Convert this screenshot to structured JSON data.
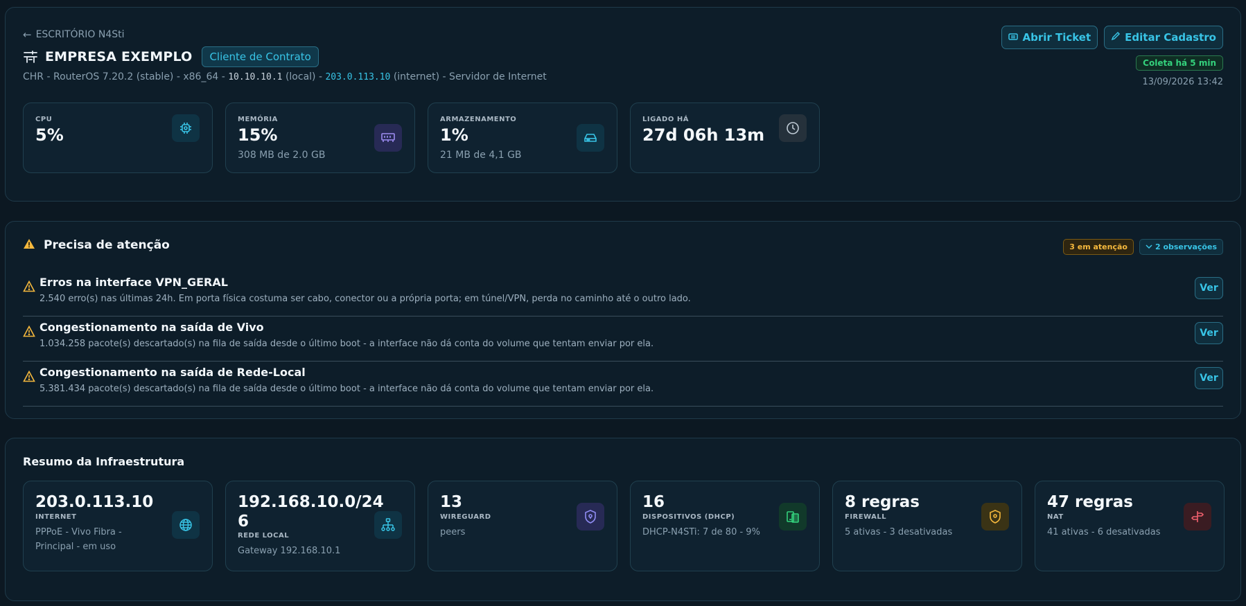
{
  "header": {
    "back_label": "ESCRITÓRIO N4Sti",
    "company": "EMPRESA EXEMPLO",
    "contract_badge": "Cliente de Contrato",
    "sub": {
      "model": "CHR - RouterOS 7.20.2 (stable) - x86_64 - ",
      "local_ip": "10.10.10.1",
      "local_label": " (local) - ",
      "public_ip": "203.0.113.10",
      "public_label": " (internet) - Servidor de Internet"
    },
    "actions": {
      "open_ticket": "Abrir Ticket",
      "edit": "Editar Cadastro"
    },
    "collect_status": "Coleta há 5 min",
    "timestamp": "13/09/2026 13:42"
  },
  "stats": [
    {
      "label": "CPU",
      "value": "5%",
      "sub": "",
      "icon": "cpu-icon"
    },
    {
      "label": "MEMÓRIA",
      "value": "15%",
      "sub": "308 MB de 2.0 GB",
      "icon": "memory-icon"
    },
    {
      "label": "ARMAZENAMENTO",
      "value": "1%",
      "sub": "21 MB de 4,1 GB",
      "icon": "storage-icon"
    },
    {
      "label": "LIGADO HÁ",
      "value": "27d 06h 13m",
      "sub": "",
      "icon": "clock-icon"
    }
  ],
  "attention": {
    "title": "Precisa de atenção",
    "badge_count": "3 em atenção",
    "badge_obs": "2 observações",
    "view_label": "Ver",
    "items": [
      {
        "title": "Erros na interface VPN_GERAL",
        "desc": "2.540 erro(s) nas últimas 24h. Em porta física costuma ser cabo, conector ou a própria porta; em túnel/VPN, perda no caminho até o outro lado."
      },
      {
        "title": "Congestionamento na saída de Vivo",
        "desc": "1.034.258 pacote(s) descartado(s) na fila de saída desde o último boot - a interface não dá conta do volume que tentam enviar por ela."
      },
      {
        "title": "Congestionamento na saída de Rede-Local",
        "desc": "5.381.434 pacote(s) descartado(s) na fila de saída desde o último boot - a interface não dá conta do volume que tentam enviar por ela."
      }
    ]
  },
  "infra": {
    "title": "Resumo da Infraestrutura",
    "cards": [
      {
        "value": "203.0.113.10",
        "label": "INTERNET",
        "sub1": "PPPoE - Vivo Fibra -",
        "sub2": "Principal - em uso",
        "icon": "globe-icon"
      },
      {
        "value1": "192.168.10.0/24",
        "value2": "6",
        "label": "REDE LOCAL",
        "sub1": "Gateway 192.168.10.1",
        "icon": "network-icon"
      },
      {
        "value": "13",
        "label": "WIREGUARD",
        "sub1": "peers",
        "icon": "shield-icon"
      },
      {
        "value": "16",
        "label": "DISPOSITIVOS (DHCP)",
        "sub1": "DHCP-N4STi: 7 de 80 - 9%",
        "icon": "devices-icon"
      },
      {
        "value": "8 regras",
        "label": "FIREWALL",
        "sub1": "5 ativas - 3 desativadas",
        "icon": "firewall-icon"
      },
      {
        "value": "47 regras",
        "label": "NAT",
        "sub1": "41 ativas - 6 desativadas",
        "icon": "nat-icon"
      }
    ]
  },
  "colors": {
    "accent": "#38c4e6",
    "warning": "#f5b83d",
    "success": "#34d17c",
    "background": "#0c1822"
  }
}
